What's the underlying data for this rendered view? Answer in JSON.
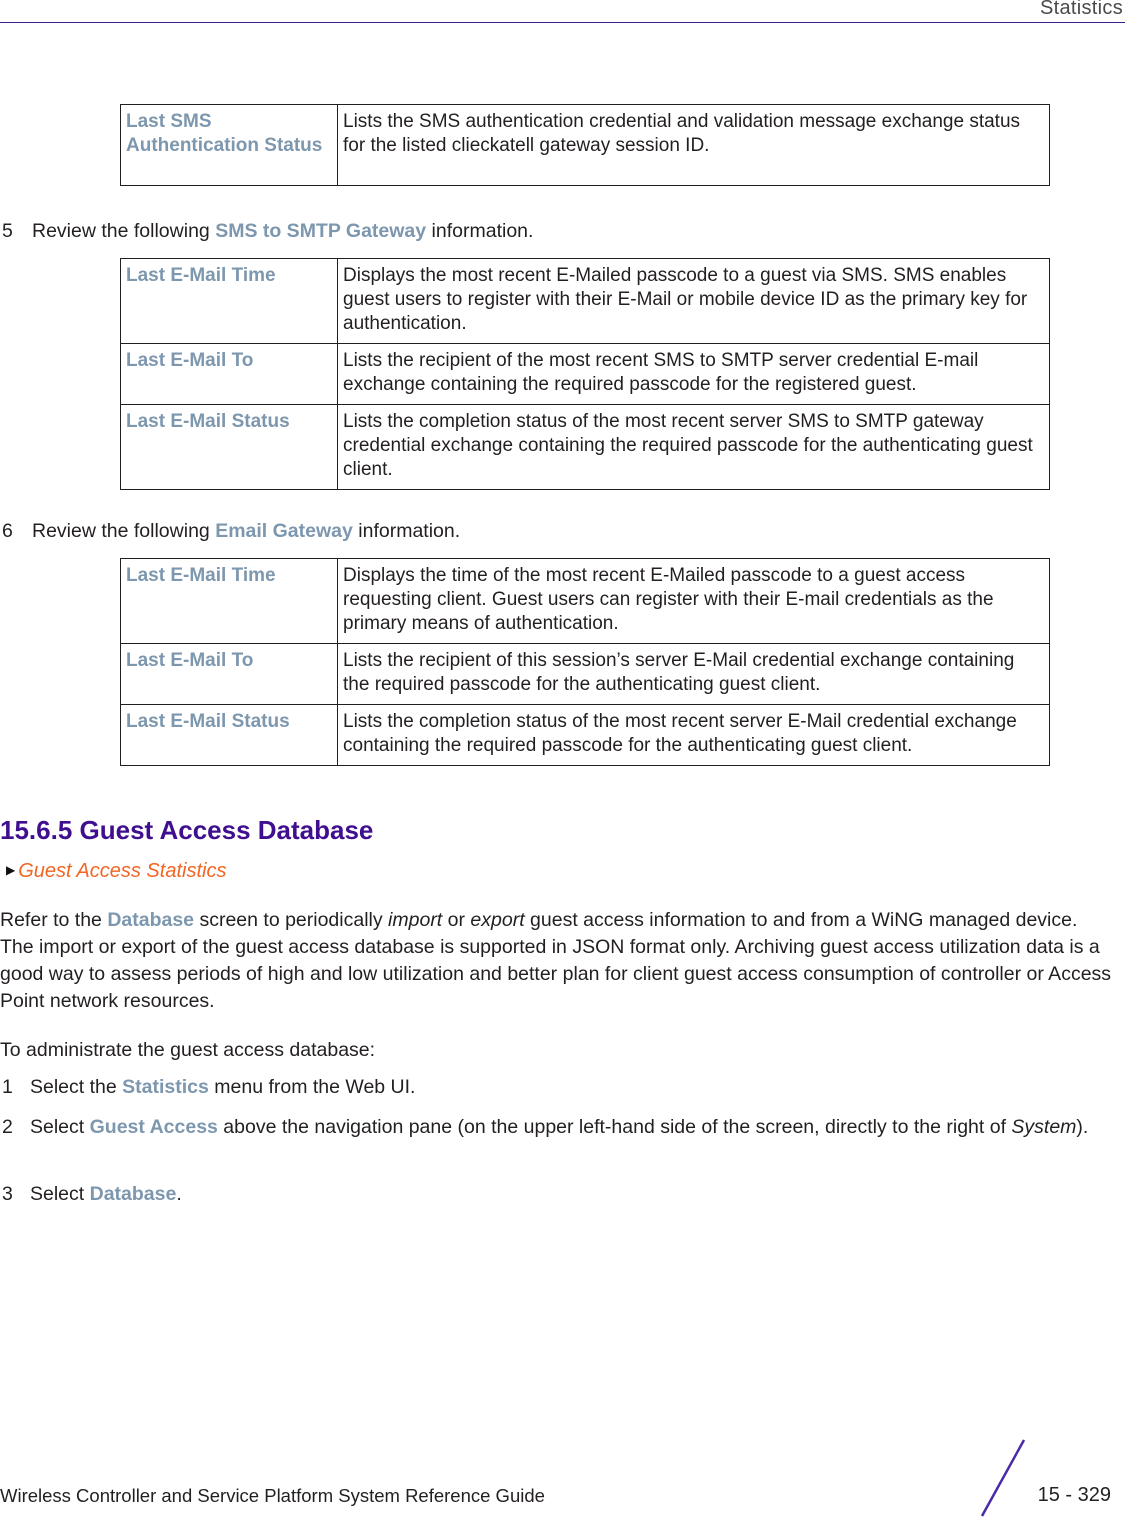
{
  "header": {
    "title": "Statistics"
  },
  "table_sms_auth": {
    "rows": [
      {
        "term": "Last SMS Authentication Status",
        "description": "Lists the SMS authentication credential and validation message exchange status for the listed clieckatell gateway session ID."
      }
    ]
  },
  "step5": {
    "number": "5",
    "prefix": "Review the following ",
    "keyword": "SMS to SMTP Gateway",
    "suffix": " information."
  },
  "table_sms_smtp": {
    "rows": [
      {
        "term": "Last E-Mail Time",
        "description": "Displays the most recent E-Mailed passcode to a guest via SMS. SMS enables guest users to register with their E-Mail or mobile device ID as the primary key for authentication."
      },
      {
        "term": "Last E-Mail To",
        "description": "Lists the recipient of the most recent SMS to SMTP server credential E-mail exchange containing the required passcode for the registered guest."
      },
      {
        "term": "Last E-Mail Status",
        "description": "Lists the completion status of the most recent server SMS to SMTP gateway credential exchange containing the required passcode for the authenticating guest client."
      }
    ]
  },
  "step6": {
    "number": "6",
    "prefix": "Review the following ",
    "keyword": "Email Gateway",
    "suffix": " information."
  },
  "table_email": {
    "rows": [
      {
        "term": "Last E-Mail Time",
        "description": "Displays the time of the most recent E-Mailed passcode to a guest access requesting client. Guest users can register with their E-mail credentials as the primary means of authentication."
      },
      {
        "term": "Last E-Mail To",
        "description": "Lists the recipient of this session’s server E-Mail credential exchange containing the required passcode for the authenticating guest client."
      },
      {
        "term": "Last E-Mail Status",
        "description": "Lists the completion status of the most recent server E-Mail credential exchange containing the required passcode for the authenticating guest client."
      }
    ]
  },
  "section": {
    "heading": "15.6.5 Guest Access Database",
    "xref": "Guest Access Statistics",
    "intro": {
      "p1": "Refer to the ",
      "kw": "Database",
      "p2": " screen to periodically ",
      "em1": "import",
      "p3": " or ",
      "em2": "export",
      "p4": " guest access information to and from a WiNG managed device. The import or export of the guest access database is supported in JSON format only. Archiving guest access utilization data is a good way to assess periods of high and low utilization and better plan for client guest access consumption of controller or Access Point network resources."
    },
    "lead": "To administrate the guest access database:",
    "steps": [
      {
        "number": "1",
        "prefix": "Select the ",
        "keyword": "Statistics",
        "suffix": " menu from the Web UI."
      },
      {
        "number": "2",
        "prefix": "Select ",
        "keyword": "Guest Access",
        "suffix": " above the navigation pane (on the upper left-hand side of the screen, directly to the right of ",
        "em": "System",
        "end": ")."
      },
      {
        "number": "3",
        "prefix": "Select ",
        "keyword": "Database",
        "suffix": "."
      }
    ]
  },
  "footer": {
    "guide_title": "Wireless Controller and Service Platform System Reference Guide",
    "page": "15 - 329"
  }
}
